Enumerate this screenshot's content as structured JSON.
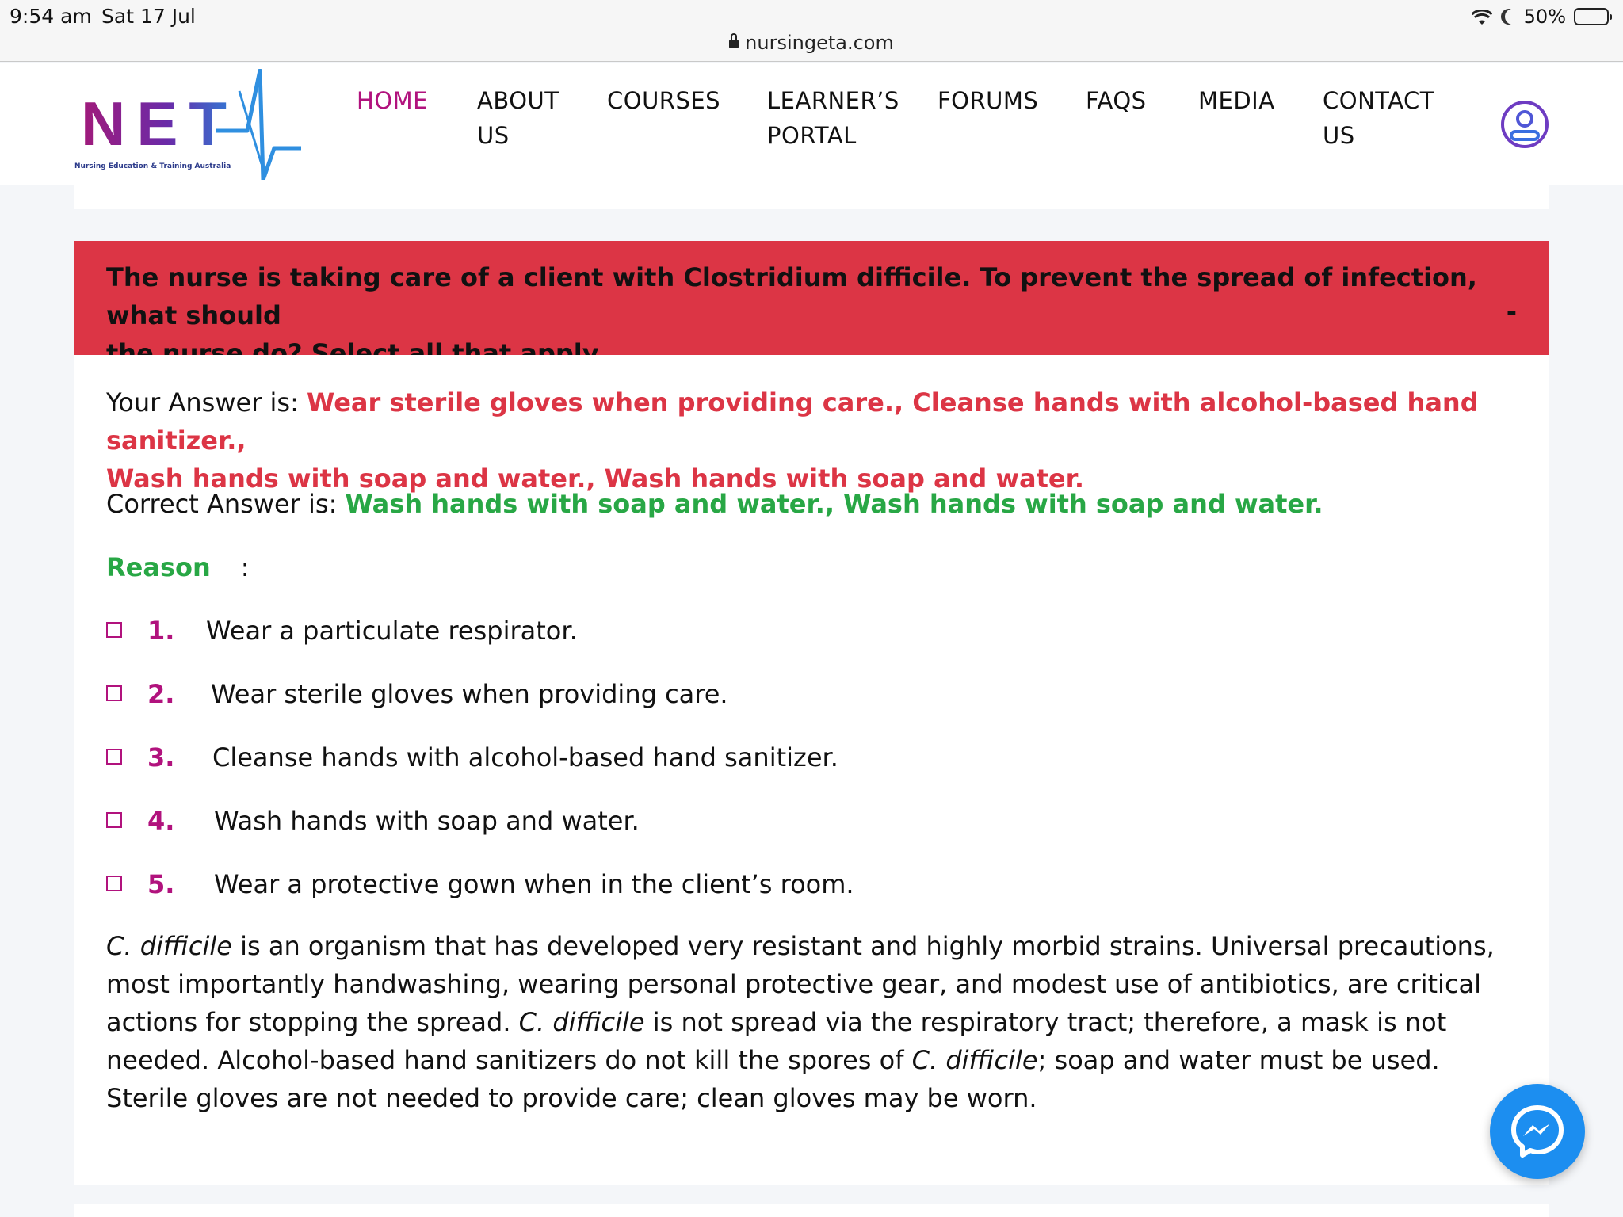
{
  "status_bar": {
    "time": "9:54 am",
    "date": "Sat 17 Jul",
    "url": "nursingeta.com",
    "battery": "50%"
  },
  "logo": {
    "letters": "NET",
    "subtitle": "Nursing Education & Training Australia"
  },
  "nav": {
    "items": [
      {
        "line1": "HOME",
        "line2": ""
      },
      {
        "line1": "ABOUT",
        "line2": "US"
      },
      {
        "line1": "COURSES",
        "line2": ""
      },
      {
        "line1": "LEARNER’S",
        "line2": "PORTAL"
      },
      {
        "line1": "FORUMS",
        "line2": ""
      },
      {
        "line1": "FAQS",
        "line2": ""
      },
      {
        "line1": "MEDIA",
        "line2": ""
      },
      {
        "line1": "CONTACT",
        "line2": "US"
      }
    ]
  },
  "question": {
    "text_line1": "The nurse is taking care of a client with Clostridium difficile. To prevent the spread of infection, what should",
    "text_line2": "the nurse do? Select all that apply.",
    "toggle": "-"
  },
  "answer": {
    "your_label": "Your Answer is: ",
    "your_value_line1": "Wear sterile gloves when providing care., Cleanse hands with alcohol-based hand sanitizer.,",
    "your_value_line2": "Wash hands with soap and water., Wash hands with soap and water.",
    "correct_label": "Correct Answer is: ",
    "correct_value": "Wash hands with soap and water., Wash hands with soap and water.",
    "reason_label": "Reason",
    "reason_colon": ":"
  },
  "options": [
    {
      "num": "1.",
      "text": "Wear a particulate respirator."
    },
    {
      "num": "2.",
      "text": "Wear sterile gloves when providing care."
    },
    {
      "num": "3.",
      "text": "Cleanse hands with alcohol-based hand sanitizer."
    },
    {
      "num": "4.",
      "text": "Wash hands with soap and water."
    },
    {
      "num": "5.",
      "text": "Wear a protective gown when in the client’s room."
    }
  ],
  "explanation": {
    "italic_1": "C. difficile",
    "text_1": " is an organism that has developed very resistant and highly morbid strains. Universal precautions, most importantly handwashing, wearing personal protective gear, and modest use of antibiotics, are critical actions for stopping the spread. ",
    "italic_2": "C. difficile",
    "text_2": " is not spread via the respiratory tract; therefore, a mask is not needed. Alcohol-based hand sanitizers do not kill the spores of ",
    "italic_3": "C. difficile",
    "text_3": "; soap and water must be used. Sterile gloves are not needed to provide care; clean gloves may be worn."
  },
  "colors": {
    "brand_magenta": "#b1127d",
    "question_bg": "#dc3545",
    "correct_green": "#28a745",
    "messenger_blue": "#1c8ef0"
  }
}
